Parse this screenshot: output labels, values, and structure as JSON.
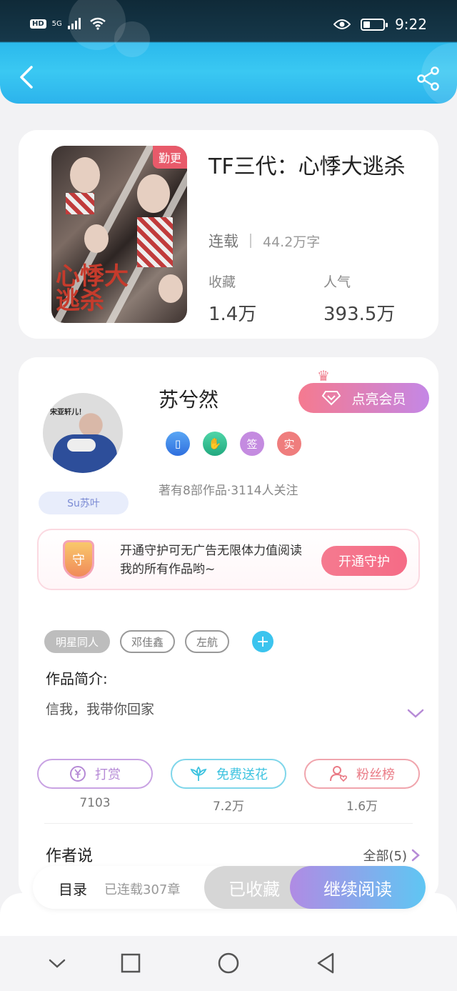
{
  "status_bar": {
    "hd": "HD",
    "network": "5G",
    "time": "9:22",
    "battery_level": 0.35
  },
  "header": {
    "back_icon": "chevron-left-icon",
    "share_icon": "share-icon",
    "accent_color": "#2db7ee"
  },
  "book": {
    "cover_tag": "勤更",
    "cover_title": "心悸大逃杀",
    "title": "TF三代：心悸大逃杀",
    "status": "连载",
    "word_count": "44.2万字",
    "favorites_label": "收藏",
    "favorites_value": "1.4万",
    "popularity_label": "人气",
    "popularity_value": "393.5万"
  },
  "author": {
    "avatar_caption": "宋亚轩儿！",
    "nickname_badge": "Su苏叶",
    "name": "苏兮然",
    "vip_button": "点亮会员",
    "badges": [
      "phone-badge-icon",
      "handshake-badge-icon",
      "签",
      "实"
    ],
    "stats": "著有8部作品·3114人关注"
  },
  "guard": {
    "shield_text": "守",
    "text": "开通守护可无广告无限体力值阅读我的所有作品哟~",
    "button": "开通守护"
  },
  "tags": {
    "primary": "明星同人",
    "items": [
      "邓佳鑫",
      "左航"
    ],
    "add_icon": "plus-icon"
  },
  "intro": {
    "label": "作品简介:",
    "text": "信我，我带你回家"
  },
  "actions": [
    {
      "label": "打赏",
      "count": "7103",
      "icon": "yen-icon",
      "color": "#b68ad6"
    },
    {
      "label": "免费送花",
      "count": "7.2万",
      "icon": "flower-icon",
      "color": "#3dc3e0"
    },
    {
      "label": "粉丝榜",
      "count": "1.6万",
      "icon": "fan-user-icon",
      "color": "#ea7b86"
    }
  ],
  "author_say": {
    "label": "作者说",
    "all_link": "全部(5)"
  },
  "bottom_bar": {
    "toc": "目录",
    "toc_status": "已连载307章",
    "collected": "已收藏",
    "continue": "继续阅读"
  },
  "nav": [
    "chevron-down-icon",
    "square-icon",
    "circle-icon",
    "triangle-back-icon"
  ]
}
